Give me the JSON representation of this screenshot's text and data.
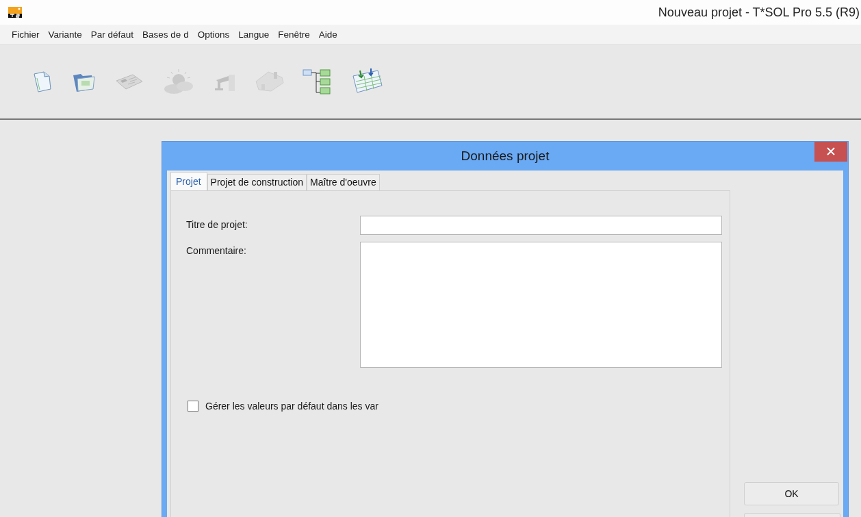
{
  "window": {
    "title": "Nouveau projet - T*SOL Pro 5.5 (R9)"
  },
  "menu": [
    "Fichier",
    "Variante",
    "Par défaut",
    "Bases de d",
    "Options",
    "Langue",
    "Fenêtre",
    "Aide"
  ],
  "toolbar": [
    {
      "kind": "document",
      "disabled": false
    },
    {
      "kind": "folder",
      "disabled": false
    },
    {
      "kind": "newspaper",
      "disabled": true
    },
    {
      "kind": "weather",
      "disabled": true
    },
    {
      "kind": "tap",
      "disabled": true
    },
    {
      "kind": "house",
      "disabled": true
    },
    {
      "kind": "tree",
      "disabled": false
    },
    {
      "kind": "table",
      "disabled": false
    }
  ],
  "dialog": {
    "title": "Données projet",
    "tabs": [
      {
        "label": "Projet",
        "selected": true
      },
      {
        "label": "Projet de construction",
        "selected": false
      },
      {
        "label": "Maître d'oeuvre",
        "selected": false
      }
    ],
    "fields": [
      {
        "label": "Titre de projet:",
        "kind": "line"
      },
      {
        "label": "Commentaire:",
        "kind": "area"
      }
    ],
    "checkbox": {
      "label": "Gérer les valeurs par défaut dans les var",
      "checked": false
    },
    "buttons": [
      "OK"
    ]
  }
}
